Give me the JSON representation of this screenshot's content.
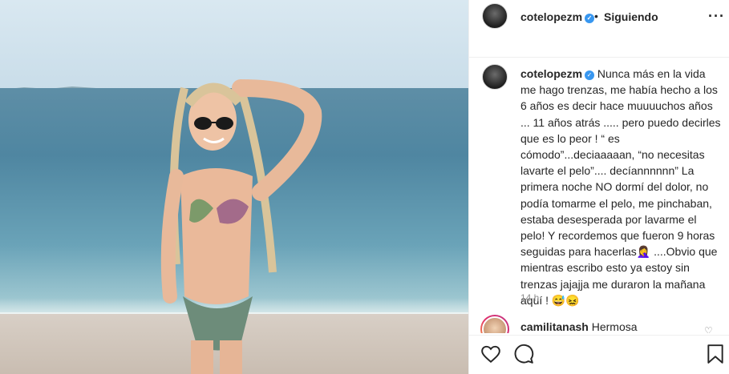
{
  "post": {
    "username": "cotelopezm",
    "dot": "•",
    "following_label": "Siguiendo",
    "caption": "Nunca más en la vida me hago trenzas, me había hecho a los 6 años es decir hace muuuuchos años ... 11 años atrás ..... pero puedo decirles que es lo peor ! “ es cómodo”...deciaaaaan, “no necesitas lavarte el pelo”.... decíannnnnn” La primera noche NO dormí del dolor, no podía tomarme el pelo, me pinchaban, estaba desesperada por lavarme el pelo! Y recordemos que fueron 9 horas seguidas para hacerlas🤦‍♀️ ....Obvio que mientras escribo esto ya estoy sin trenzas jajajja me duraron la mañana aquí ! 😅😖",
    "time": "14 h"
  },
  "comments": [
    {
      "username": "camilitanash",
      "text": "Hermosa"
    }
  ],
  "icons": {
    "more": "more-options-icon",
    "verified": "verified-badge-icon",
    "like": "heart-icon",
    "comment": "comment-icon",
    "save": "bookmark-icon"
  },
  "colors": {
    "verified": "#3897f0",
    "muted": "#8e8e8e",
    "text": "#262626"
  }
}
